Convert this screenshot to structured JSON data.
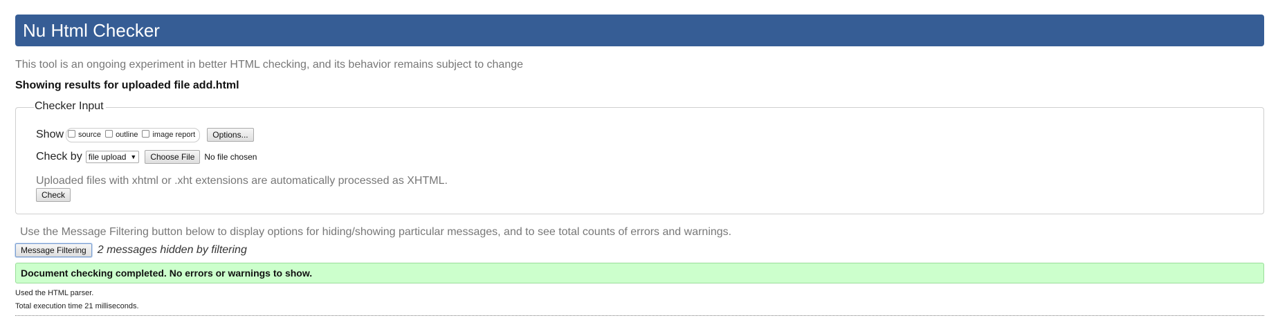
{
  "header": {
    "title": "Nu Html Checker"
  },
  "intro": "This tool is an ongoing experiment in better HTML checking, and its behavior remains subject to change",
  "results_title": "Showing results for uploaded file add.html",
  "checker_input": {
    "legend": "Checker Input",
    "show_label": "Show",
    "show_options": [
      {
        "label": "source",
        "checked": false
      },
      {
        "label": "outline",
        "checked": false
      },
      {
        "label": "image report",
        "checked": false
      }
    ],
    "options_button": "Options...",
    "check_by_label": "Check by",
    "check_by_selected": "file upload",
    "choose_file_button": "Choose File",
    "file_status": "No file chosen",
    "xhtml_note": "Uploaded files with xhtml or .xht extensions are automatically processed as XHTML.",
    "check_button": "Check"
  },
  "filtering": {
    "note": "Use the Message Filtering button below to display options for hiding/showing particular messages, and to see total counts of errors and warnings.",
    "button": "Message Filtering",
    "hidden_count": "2 messages hidden by filtering"
  },
  "result": {
    "message": "Document checking completed. No errors or warnings to show.",
    "parser_note": "Used the HTML parser.",
    "time_note": "Total execution time 21 milliseconds."
  },
  "colors": {
    "header_bg": "#365d95",
    "success_bg": "#ccffcc"
  }
}
